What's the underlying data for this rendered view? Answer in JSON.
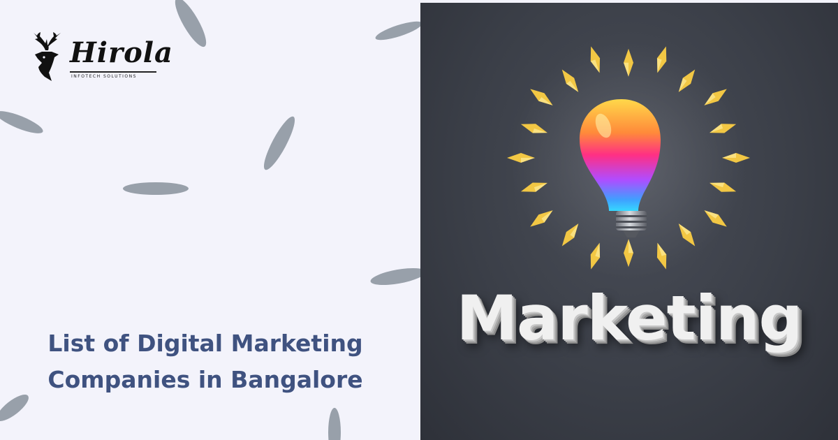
{
  "brand": {
    "name": "Hirola",
    "tagline": "INFOTECH SOLUTIONS",
    "logo_icon": "stag-head-icon"
  },
  "headline": {
    "line1": "List of Digital Marketing",
    "line2": "Companies in Bangalore"
  },
  "hero": {
    "word": "Marketing",
    "icon": "lightbulb-icon",
    "rays_icon": "sparkle-rays-icon"
  },
  "colors": {
    "left_background": "#f3f3fb",
    "headline": "#3f5280",
    "blob": "#98a0aa",
    "right_background": "#3b3f48",
    "ray": "#f2c744"
  }
}
